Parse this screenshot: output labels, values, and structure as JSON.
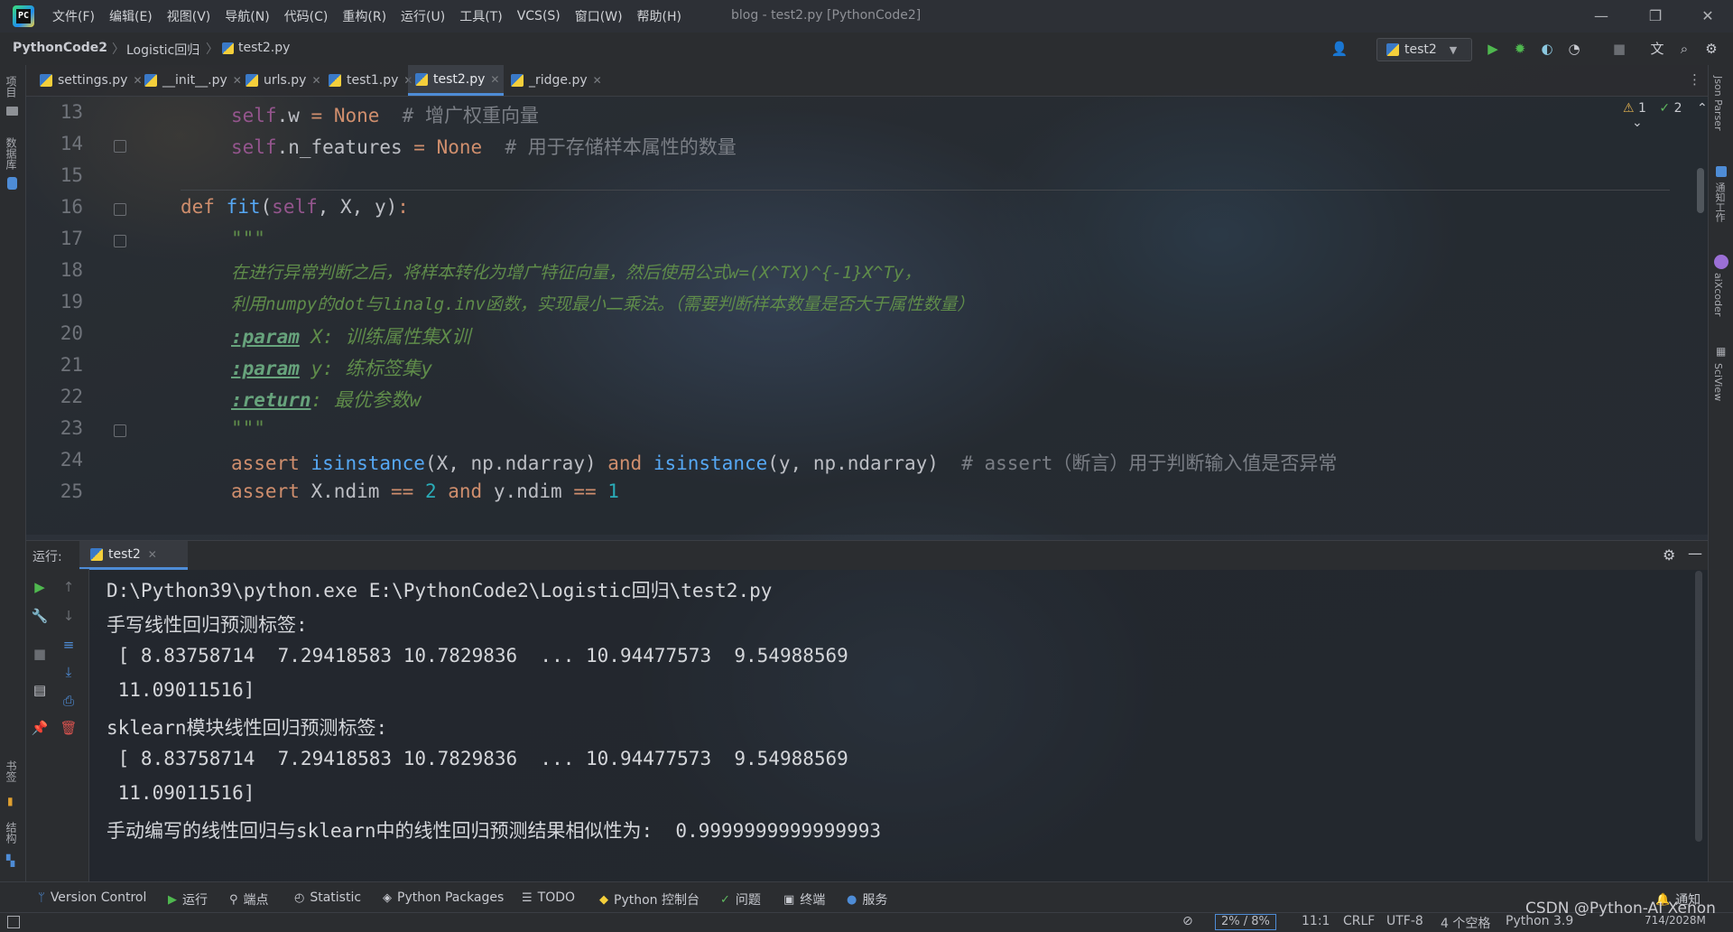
{
  "menu": {
    "logo_text": "PC",
    "items": [
      "文件(F)",
      "编辑(E)",
      "视图(V)",
      "导航(N)",
      "代码(C)",
      "重构(R)",
      "运行(U)",
      "工具(T)",
      "VCS(S)",
      "窗口(W)",
      "帮助(H)"
    ],
    "window_title": "blog - test2.py [PythonCode2]"
  },
  "breadcrumb": [
    "PythonCode2",
    "Logistic回归",
    "test2.py"
  ],
  "run_config": "test2",
  "tabs": [
    {
      "label": "settings.py",
      "active": false
    },
    {
      "label": "__init__.py",
      "active": false
    },
    {
      "label": "urls.py",
      "active": false
    },
    {
      "label": "test1.py",
      "active": false
    },
    {
      "label": "test2.py",
      "active": true
    },
    {
      "label": "_ridge.py",
      "active": false
    }
  ],
  "inspections": {
    "warnings": "1",
    "weak_warnings": "2"
  },
  "left_stripe": {
    "project": "项目",
    "database": "数据库",
    "bookmarks": "书签",
    "structure": "结构"
  },
  "right_stripe": {
    "json_parser": "Json Parser",
    "notifications": "通知工作",
    "aixcoder": "aiXcoder",
    "sciview": "SciView"
  },
  "editor": {
    "line_numbers": [
      "13",
      "14",
      "15",
      "16",
      "17",
      "18",
      "19",
      "20",
      "21",
      "22",
      "23",
      "24",
      "25"
    ],
    "lines": {
      "l13_self": "self",
      "l13_attr": ".w ",
      "l13_eq": "= ",
      "l13_none": "None",
      "l13_comment": "  # 增广权重向量",
      "l14_self": "self",
      "l14_attr": ".n_features ",
      "l14_eq": "= ",
      "l14_none": "None",
      "l14_comment": "  # 用于存储样本属性的数量",
      "l16_def": "def ",
      "l16_fn": "fit",
      "l16_open": "(",
      "l16_self": "self",
      "l16_rest": ", X, y)",
      "l16_colon": ":",
      "l17": "\"\"\"",
      "l18": "在进行异常判断之后，将样本转化为增广特征向量，然后使用公式w=(X^TX)^{-1}X^Ty，",
      "l19": "利用numpy的dot与linalg.inv函数，实现最小二乘法。（需要判断样本数量是否大于属性数量）",
      "l20_tag": ":param",
      "l20_rest": " X: 训练属性集X训",
      "l21_tag": ":param",
      "l21_rest": " y: 练标签集y",
      "l22_tag": ":return",
      "l22_rest": ": 最优参数w",
      "l23": "\"\"\"",
      "l24_assert": "assert ",
      "l24_isinst": "isinstance",
      "l24_a": "(X, np.ndarray) ",
      "l24_and": "and ",
      "l24_isinst2": "isinstance",
      "l24_b": "(y, np.ndarray)",
      "l24_comment": "  # assert（断言）用于判断输入值是否异常",
      "l25_assert": "assert ",
      "l25_a": "X.ndim ",
      "l25_eq": "== ",
      "l25_two": "2",
      "l25_and": " and ",
      "l25_b": "y.ndim ",
      "l25_eq2": "== ",
      "l25_one": "1"
    }
  },
  "run_panel": {
    "label": "运行:",
    "tab": "test2",
    "output": [
      "D:\\Python39\\python.exe E:\\PythonCode2\\Logistic回归\\test2.py",
      "手写线性回归预测标签:",
      " [ 8.83758714  7.29418583 10.7829836  ... 10.94477573  9.54988569",
      " 11.09011516]",
      "sklearn模块线性回归预测标签:",
      " [ 8.83758714  7.29418583 10.7829836  ... 10.94477573  9.54988569",
      " 11.09011516]",
      "手动编写的线性回归与sklearn中的线性回归预测结果相似性为:  0.9999999999999993"
    ]
  },
  "toolbar": {
    "version_control": "Version Control",
    "run": "运行",
    "endpoints": "端点",
    "statistic": "Statistic",
    "python_packages": "Python Packages",
    "todo": "TODO",
    "python_console": "Python 控制台",
    "problems": "问题",
    "terminal": "终端",
    "services": "服务",
    "notifications": "通知"
  },
  "statusbar": {
    "memory": "2% / 8%",
    "position": "11:1",
    "line_sep": "CRLF",
    "encoding": "UTF-8",
    "indent": "4 个空格",
    "interpreter": "Python 3.9",
    "memory_usage": "714/2028M"
  },
  "watermark": "CSDN @Python-AI Xenon",
  "colors": {
    "accent": "#4e8cd6",
    "keyword": "#cf8e6d",
    "docstring": "#5f8c4a",
    "number": "#2aacb8"
  }
}
